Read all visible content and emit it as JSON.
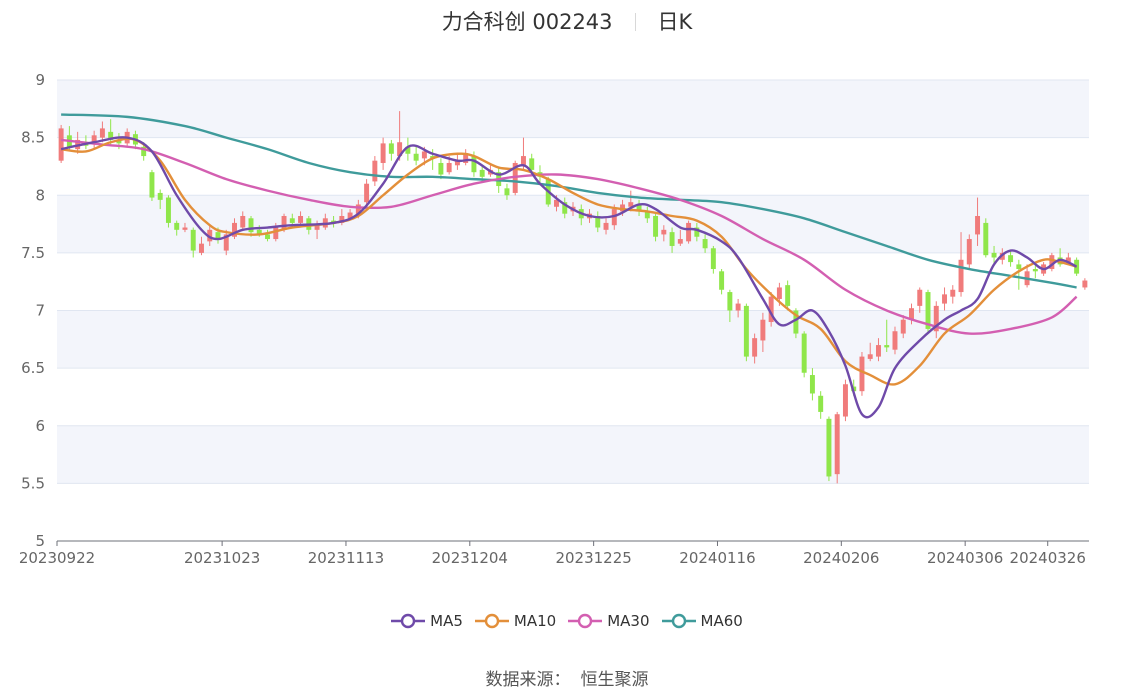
{
  "header": {
    "stock": "力合科创 002243",
    "period": "日K"
  },
  "source": {
    "label": "数据来源：",
    "value": "恒生聚源"
  },
  "colors": {
    "up": "#f07b7b",
    "down": "#8fe64a",
    "band": "#f3f5fb",
    "grid": "#e0e6f1"
  },
  "chart_data": {
    "type": "candlestick",
    "ylim": [
      5,
      9
    ],
    "yticks": [
      "5",
      "5.5",
      "6",
      "6.5",
      "7",
      "7.5",
      "8",
      "8.5",
      "9"
    ],
    "xticks": [
      "20230922",
      "20231023",
      "20231113",
      "20231204",
      "20231225",
      "20240116",
      "20240206",
      "20240306",
      "20240326"
    ],
    "xtick_positions": [
      0,
      20,
      35,
      50,
      65,
      80,
      95,
      110,
      120
    ],
    "legend": [
      {
        "name": "MA5",
        "color": "#6f4aa9"
      },
      {
        "name": "MA10",
        "color": "#e38f3a"
      },
      {
        "name": "MA30",
        "color": "#d35fb1"
      },
      {
        "name": "MA60",
        "color": "#3f9b9b"
      }
    ],
    "candles": [
      [
        8.3,
        8.58,
        8.61,
        8.28
      ],
      [
        8.52,
        8.42,
        8.6,
        8.38
      ],
      [
        8.4,
        8.48,
        8.55,
        8.36
      ],
      [
        8.45,
        8.43,
        8.52,
        8.4
      ],
      [
        8.44,
        8.52,
        8.56,
        8.4
      ],
      [
        8.5,
        8.58,
        8.64,
        8.46
      ],
      [
        8.55,
        8.48,
        8.66,
        8.44
      ],
      [
        8.48,
        8.45,
        8.54,
        8.4
      ],
      [
        8.45,
        8.55,
        8.58,
        8.43
      ],
      [
        8.53,
        8.44,
        8.56,
        8.4
      ],
      [
        8.42,
        8.34,
        8.46,
        8.3
      ],
      [
        8.2,
        7.98,
        8.22,
        7.95
      ],
      [
        8.02,
        7.96,
        8.05,
        7.88
      ],
      [
        7.98,
        7.76,
        8.0,
        7.72
      ],
      [
        7.76,
        7.7,
        7.78,
        7.65
      ],
      [
        7.7,
        7.72,
        7.76,
        7.68
      ],
      [
        7.7,
        7.52,
        7.72,
        7.46
      ],
      [
        7.5,
        7.58,
        7.64,
        7.48
      ],
      [
        7.6,
        7.7,
        7.75,
        7.56
      ],
      [
        7.68,
        7.62,
        7.72,
        7.58
      ],
      [
        7.52,
        7.66,
        7.7,
        7.48
      ],
      [
        7.64,
        7.76,
        7.8,
        7.62
      ],
      [
        7.72,
        7.82,
        7.86,
        7.7
      ],
      [
        7.8,
        7.68,
        7.82,
        7.64
      ],
      [
        7.7,
        7.66,
        7.74,
        7.64
      ],
      [
        7.66,
        7.62,
        7.7,
        7.6
      ],
      [
        7.62,
        7.72,
        7.76,
        7.6
      ],
      [
        7.7,
        7.82,
        7.84,
        7.68
      ],
      [
        7.8,
        7.76,
        7.84,
        7.72
      ],
      [
        7.76,
        7.82,
        7.86,
        7.74
      ],
      [
        7.8,
        7.7,
        7.82,
        7.66
      ],
      [
        7.7,
        7.74,
        7.78,
        7.62
      ],
      [
        7.72,
        7.8,
        7.84,
        7.7
      ],
      [
        7.78,
        7.76,
        7.82,
        7.72
      ],
      [
        7.76,
        7.82,
        7.88,
        7.74
      ],
      [
        7.8,
        7.85,
        7.88,
        7.78
      ],
      [
        7.84,
        7.92,
        7.96,
        7.8
      ],
      [
        7.94,
        8.1,
        8.14,
        7.9
      ],
      [
        8.12,
        8.3,
        8.34,
        8.08
      ],
      [
        8.28,
        8.45,
        8.5,
        8.22
      ],
      [
        8.45,
        8.36,
        8.48,
        8.3
      ],
      [
        8.34,
        8.46,
        8.73,
        8.3
      ],
      [
        8.42,
        8.36,
        8.5,
        8.3
      ],
      [
        8.36,
        8.3,
        8.42,
        8.26
      ],
      [
        8.32,
        8.38,
        8.42,
        8.26
      ],
      [
        8.34,
        8.32,
        8.4,
        8.22
      ],
      [
        8.28,
        8.18,
        8.32,
        8.14
      ],
      [
        8.2,
        8.28,
        8.34,
        8.18
      ],
      [
        8.26,
        8.3,
        8.36,
        8.22
      ],
      [
        8.28,
        8.36,
        8.4,
        8.26
      ],
      [
        8.34,
        8.2,
        8.38,
        8.16
      ],
      [
        8.22,
        8.16,
        8.26,
        8.12
      ],
      [
        8.18,
        8.22,
        8.28,
        8.16
      ],
      [
        8.2,
        8.08,
        8.24,
        8.02
      ],
      [
        8.06,
        8.0,
        8.1,
        7.96
      ],
      [
        8.02,
        8.28,
        8.3,
        8.0
      ],
      [
        8.26,
        8.34,
        8.5,
        8.22
      ],
      [
        8.32,
        8.22,
        8.36,
        8.18
      ],
      [
        8.2,
        8.16,
        8.26,
        8.1
      ],
      [
        8.14,
        7.92,
        8.16,
        7.9
      ],
      [
        7.9,
        7.96,
        8.0,
        7.86
      ],
      [
        7.94,
        7.84,
        7.98,
        7.8
      ],
      [
        7.86,
        7.9,
        7.94,
        7.82
      ],
      [
        7.88,
        7.8,
        7.92,
        7.74
      ],
      [
        7.8,
        7.84,
        7.88,
        7.76
      ],
      [
        7.82,
        7.72,
        7.86,
        7.68
      ],
      [
        7.7,
        7.76,
        7.8,
        7.66
      ],
      [
        7.74,
        7.88,
        7.92,
        7.7
      ],
      [
        7.86,
        7.92,
        7.96,
        7.82
      ],
      [
        7.9,
        7.94,
        8.04,
        7.86
      ],
      [
        7.92,
        7.86,
        7.96,
        7.82
      ],
      [
        7.86,
        7.8,
        7.9,
        7.76
      ],
      [
        7.82,
        7.64,
        7.84,
        7.6
      ],
      [
        7.66,
        7.7,
        7.74,
        7.6
      ],
      [
        7.68,
        7.56,
        7.72,
        7.5
      ],
      [
        7.58,
        7.62,
        7.7,
        7.56
      ],
      [
        7.6,
        7.76,
        7.78,
        7.58
      ],
      [
        7.72,
        7.64,
        7.76,
        7.6
      ],
      [
        7.62,
        7.54,
        7.66,
        7.5
      ],
      [
        7.54,
        7.36,
        7.56,
        7.32
      ],
      [
        7.34,
        7.18,
        7.36,
        7.14
      ],
      [
        7.16,
        7.0,
        7.18,
        6.9
      ],
      [
        7.0,
        7.06,
        7.1,
        6.94
      ],
      [
        7.04,
        6.6,
        7.06,
        6.56
      ],
      [
        6.6,
        6.76,
        6.8,
        6.54
      ],
      [
        6.74,
        6.92,
        6.98,
        6.64
      ],
      [
        6.9,
        7.12,
        7.16,
        6.86
      ],
      [
        7.1,
        7.2,
        7.24,
        7.04
      ],
      [
        7.22,
        7.04,
        7.26,
        7.0
      ],
      [
        7.0,
        6.8,
        7.02,
        6.76
      ],
      [
        6.8,
        6.46,
        6.82,
        6.42
      ],
      [
        6.44,
        6.28,
        6.5,
        6.22
      ],
      [
        6.26,
        6.12,
        6.3,
        6.06
      ],
      [
        6.06,
        5.56,
        6.08,
        5.52
      ],
      [
        5.58,
        6.1,
        6.12,
        5.5
      ],
      [
        6.08,
        6.36,
        6.4,
        6.04
      ],
      [
        6.34,
        6.3,
        6.4,
        6.26
      ],
      [
        6.3,
        6.6,
        6.64,
        6.26
      ],
      [
        6.58,
        6.62,
        6.72,
        6.56
      ],
      [
        6.6,
        6.7,
        6.76,
        6.56
      ],
      [
        6.7,
        6.68,
        6.92,
        6.64
      ],
      [
        6.66,
        6.82,
        6.86,
        6.62
      ],
      [
        6.8,
        6.92,
        6.96,
        6.76
      ],
      [
        6.92,
        7.02,
        7.06,
        6.88
      ],
      [
        7.04,
        7.18,
        7.2,
        6.98
      ],
      [
        7.16,
        6.84,
        7.18,
        6.8
      ],
      [
        6.82,
        7.04,
        7.08,
        6.76
      ],
      [
        7.06,
        7.14,
        7.2,
        7.0
      ],
      [
        7.12,
        7.18,
        7.22,
        7.06
      ],
      [
        7.16,
        7.44,
        7.68,
        7.12
      ],
      [
        7.4,
        7.62,
        7.66,
        7.36
      ],
      [
        7.66,
        7.82,
        7.98,
        7.56
      ],
      [
        7.76,
        7.48,
        7.8,
        7.46
      ],
      [
        7.5,
        7.46,
        7.56,
        7.4
      ],
      [
        7.44,
        7.5,
        7.54,
        7.4
      ],
      [
        7.48,
        7.42,
        7.52,
        7.38
      ],
      [
        7.4,
        7.36,
        7.44,
        7.18
      ],
      [
        7.22,
        7.34,
        7.4,
        7.2
      ],
      [
        7.36,
        7.34,
        7.42,
        7.28
      ],
      [
        7.32,
        7.4,
        7.42,
        7.3
      ],
      [
        7.36,
        7.48,
        7.5,
        7.34
      ],
      [
        7.46,
        7.4,
        7.54,
        7.38
      ],
      [
        7.42,
        7.46,
        7.5,
        7.4
      ],
      [
        7.44,
        7.32,
        7.46,
        7.3
      ],
      [
        7.2,
        7.26,
        7.28,
        7.18
      ]
    ],
    "ma": {
      "MA5": [
        [
          0,
          8.4
        ],
        [
          4,
          8.46
        ],
        [
          8,
          8.5
        ],
        [
          11,
          8.38
        ],
        [
          14,
          8.0
        ],
        [
          17,
          7.7
        ],
        [
          19,
          7.62
        ],
        [
          22,
          7.7
        ],
        [
          25,
          7.72
        ],
        [
          28,
          7.74
        ],
        [
          33,
          7.76
        ],
        [
          36,
          7.84
        ],
        [
          39,
          8.1
        ],
        [
          42,
          8.42
        ],
        [
          45,
          8.36
        ],
        [
          48,
          8.3
        ],
        [
          50,
          8.3
        ],
        [
          53,
          8.18
        ],
        [
          56,
          8.26
        ],
        [
          58,
          8.1
        ],
        [
          61,
          7.92
        ],
        [
          64,
          7.82
        ],
        [
          67,
          7.82
        ],
        [
          70,
          7.92
        ],
        [
          72,
          7.88
        ],
        [
          75,
          7.72
        ],
        [
          77,
          7.7
        ],
        [
          80,
          7.6
        ],
        [
          82,
          7.46
        ],
        [
          85,
          7.1
        ],
        [
          87,
          6.88
        ],
        [
          89,
          6.92
        ],
        [
          91,
          7.0
        ],
        [
          93,
          6.82
        ],
        [
          95,
          6.52
        ],
        [
          97,
          6.1
        ],
        [
          99,
          6.16
        ],
        [
          101,
          6.5
        ],
        [
          104,
          6.74
        ],
        [
          107,
          6.92
        ],
        [
          109,
          7.0
        ],
        [
          111,
          7.1
        ],
        [
          113,
          7.4
        ],
        [
          115,
          7.52
        ],
        [
          117,
          7.46
        ],
        [
          119,
          7.36
        ],
        [
          121,
          7.44
        ],
        [
          123,
          7.38
        ]
      ],
      "MA10": [
        [
          0,
          8.4
        ],
        [
          3,
          8.38
        ],
        [
          6,
          8.46
        ],
        [
          9,
          8.48
        ],
        [
          12,
          8.3
        ],
        [
          15,
          7.96
        ],
        [
          18,
          7.74
        ],
        [
          20,
          7.68
        ],
        [
          24,
          7.66
        ],
        [
          28,
          7.72
        ],
        [
          33,
          7.76
        ],
        [
          36,
          7.82
        ],
        [
          39,
          8.0
        ],
        [
          42,
          8.18
        ],
        [
          45,
          8.32
        ],
        [
          48,
          8.36
        ],
        [
          50,
          8.34
        ],
        [
          53,
          8.24
        ],
        [
          56,
          8.22
        ],
        [
          59,
          8.14
        ],
        [
          62,
          8.02
        ],
        [
          65,
          7.92
        ],
        [
          68,
          7.88
        ],
        [
          71,
          7.86
        ],
        [
          74,
          7.82
        ],
        [
          77,
          7.78
        ],
        [
          80,
          7.64
        ],
        [
          83,
          7.36
        ],
        [
          86,
          7.14
        ],
        [
          89,
          6.96
        ],
        [
          92,
          6.84
        ],
        [
          95,
          6.56
        ],
        [
          98,
          6.44
        ],
        [
          101,
          6.36
        ],
        [
          104,
          6.52
        ],
        [
          107,
          6.8
        ],
        [
          110,
          6.96
        ],
        [
          113,
          7.18
        ],
        [
          116,
          7.34
        ],
        [
          119,
          7.44
        ],
        [
          121,
          7.42
        ],
        [
          123,
          7.38
        ]
      ],
      "MA30": [
        [
          0,
          8.48
        ],
        [
          5,
          8.44
        ],
        [
          10,
          8.4
        ],
        [
          15,
          8.28
        ],
        [
          20,
          8.14
        ],
        [
          25,
          8.04
        ],
        [
          30,
          7.96
        ],
        [
          35,
          7.9
        ],
        [
          40,
          7.9
        ],
        [
          45,
          8.0
        ],
        [
          50,
          8.1
        ],
        [
          55,
          8.16
        ],
        [
          60,
          8.18
        ],
        [
          65,
          8.14
        ],
        [
          70,
          8.06
        ],
        [
          75,
          7.96
        ],
        [
          80,
          7.82
        ],
        [
          85,
          7.62
        ],
        [
          90,
          7.44
        ],
        [
          95,
          7.18
        ],
        [
          100,
          7.0
        ],
        [
          105,
          6.88
        ],
        [
          110,
          6.8
        ],
        [
          115,
          6.84
        ],
        [
          120,
          6.94
        ],
        [
          123,
          7.12
        ]
      ],
      "MA60": [
        [
          0,
          8.7
        ],
        [
          8,
          8.68
        ],
        [
          15,
          8.6
        ],
        [
          20,
          8.5
        ],
        [
          25,
          8.4
        ],
        [
          30,
          8.28
        ],
        [
          35,
          8.2
        ],
        [
          40,
          8.16
        ],
        [
          45,
          8.16
        ],
        [
          50,
          8.14
        ],
        [
          55,
          8.12
        ],
        [
          60,
          8.08
        ],
        [
          65,
          8.02
        ],
        [
          70,
          7.98
        ],
        [
          75,
          7.96
        ],
        [
          80,
          7.94
        ],
        [
          85,
          7.88
        ],
        [
          90,
          7.8
        ],
        [
          95,
          7.68
        ],
        [
          100,
          7.56
        ],
        [
          105,
          7.44
        ],
        [
          110,
          7.36
        ],
        [
          115,
          7.3
        ],
        [
          120,
          7.24
        ],
        [
          123,
          7.2
        ]
      ]
    }
  }
}
